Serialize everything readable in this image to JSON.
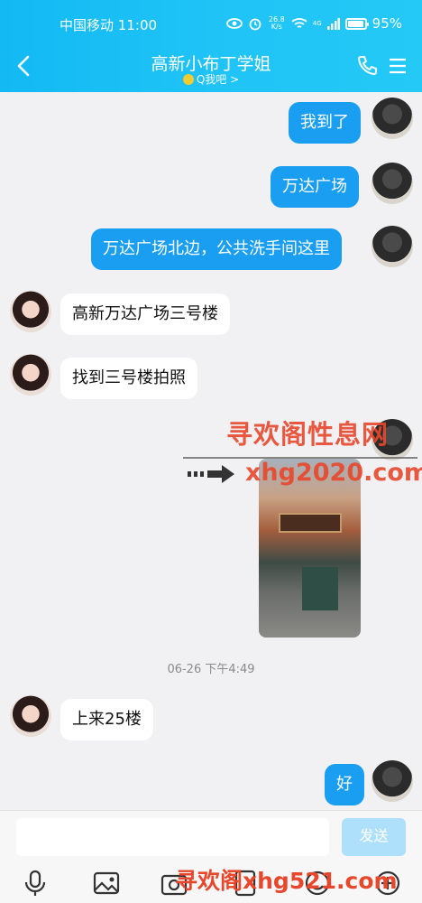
{
  "status_bar": {
    "carrier": "中国移动",
    "time": "11:00",
    "net_speed": "26.8",
    "net_unit": "K/s",
    "signal_tag": "4G",
    "battery": "95%"
  },
  "titlebar": {
    "title": "高新小布丁学姐",
    "subtitle": "Q我吧 >"
  },
  "messages": {
    "m1": "我到了",
    "m2": "万达广场",
    "m3": "万达广场北边，公共洗手间这里",
    "m4": "高新万达广场三号楼",
    "m5": "找到三号楼拍照",
    "m6": "上来25楼",
    "m7": "好"
  },
  "timestamp": "06-26 下午4:49",
  "watermarks": {
    "w1": "寻欢阁性息网",
    "w2": "xhg2020.com",
    "w3": "寻欢阁xhg521.com"
  },
  "input": {
    "placeholder": "",
    "send_label": "发送"
  },
  "colors": {
    "header": "#1fc3f6",
    "bubble_out": "#1a9ef2",
    "send_disabled": "#aee0fb"
  }
}
